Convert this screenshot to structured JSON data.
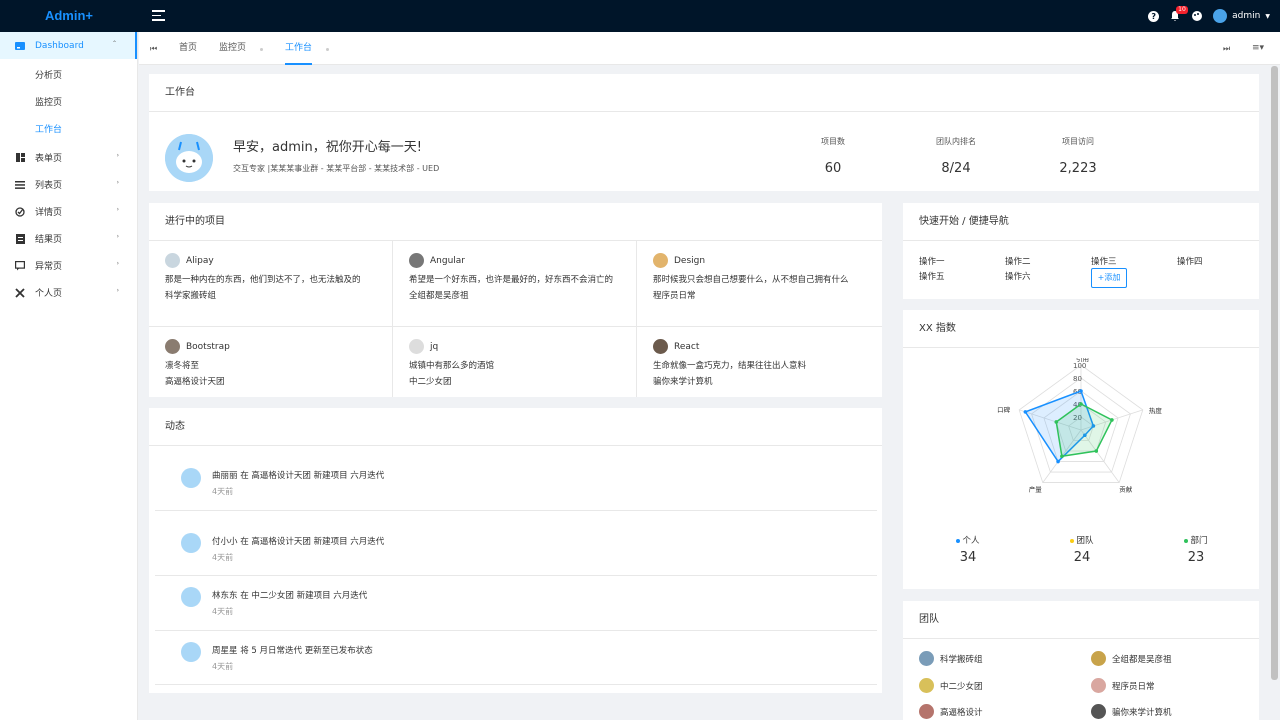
{
  "app": {
    "title": "Admin+"
  },
  "header": {
    "badge_count": "10",
    "user_name": "admin"
  },
  "sidebar": {
    "dashboard": "Dashboard",
    "sub": [
      "分析页",
      "监控页",
      "工作台"
    ],
    "items": [
      "表单页",
      "列表页",
      "详情页",
      "结果页",
      "异常页",
      "个人页"
    ]
  },
  "tabs": [
    "首页",
    "监控页",
    "工作台"
  ],
  "workbench": {
    "title": "工作台",
    "greeting": "早安，admin，祝你开心每一天!",
    "subtitle": "交互专家 |某某某事业群 - 某某平台部 - 某某技术部 - UED",
    "stats": [
      {
        "label": "项目数",
        "value": "60"
      },
      {
        "label": "团队内排名",
        "value": "8/24"
      },
      {
        "label": "项目访问",
        "value": "2,223"
      }
    ]
  },
  "projects": {
    "title": "进行中的项目",
    "items": [
      {
        "name": "Alipay",
        "desc": "那是一种内在的东西，他们到达不了，也无法触及的",
        "group": "科学家搬砖组"
      },
      {
        "name": "Angular",
        "desc": "希望是一个好东西，也许是最好的，好东西不会消亡的",
        "group": "全组都是吴彦祖"
      },
      {
        "name": "Design",
        "desc": "那时候我只会想自己想要什么，从不想自己拥有什么",
        "group": "程序员日常"
      },
      {
        "name": "Bootstrap",
        "desc": "凛冬将至",
        "group": "高逼格设计天团"
      },
      {
        "name": "jq",
        "desc": "城镇中有那么多的酒馆",
        "group": "中二少女团"
      },
      {
        "name": "React",
        "desc": "生命就像一盒巧克力，结果往往出人意料",
        "group": "骗你来学计算机"
      }
    ]
  },
  "activity": {
    "title": "动态",
    "items": [
      {
        "text": "曲丽丽 在 高逼格设计天团 新建项目 六月迭代",
        "time": "4天前"
      },
      {
        "text": "付小小 在 高逼格设计天团 新建项目 六月迭代",
        "time": "4天前"
      },
      {
        "text": "林东东 在 中二少女团 新建项目 六月迭代",
        "time": "4天前"
      },
      {
        "text": "周星星 将 5 月日常迭代 更新至已发布状态",
        "time": "4天前"
      }
    ]
  },
  "quick": {
    "title": "快速开始 / 便捷导航",
    "ops": [
      "操作一",
      "操作二",
      "操作三",
      "操作四",
      "操作五",
      "操作六"
    ],
    "add_label": "+添加"
  },
  "radar": {
    "title": "XX 指数",
    "legend": [
      {
        "name": "个人",
        "value": "34",
        "color": "#1890ff"
      },
      {
        "name": "团队",
        "value": "24",
        "color": "#facc14"
      },
      {
        "name": "部门",
        "value": "23",
        "color": "#2fc25b"
      }
    ]
  },
  "chart_data": {
    "type": "radar",
    "axes": [
      "引用",
      "热度",
      "贡献",
      "产量",
      "口碑"
    ],
    "ticks": [
      "100",
      "80",
      "60",
      "40",
      "20"
    ],
    "range": [
      0,
      100
    ],
    "series": [
      {
        "name": "个人",
        "values": [
          60,
          20,
          10,
          60,
          90
        ]
      },
      {
        "name": "部门",
        "values": [
          40,
          50,
          40,
          50,
          40
        ]
      }
    ]
  },
  "team": {
    "title": "团队",
    "items": [
      "科学搬砖组",
      "全组都是吴彦祖",
      "中二少女团",
      "程序员日常",
      "高逼格设计",
      "骗你来学计算机"
    ]
  }
}
